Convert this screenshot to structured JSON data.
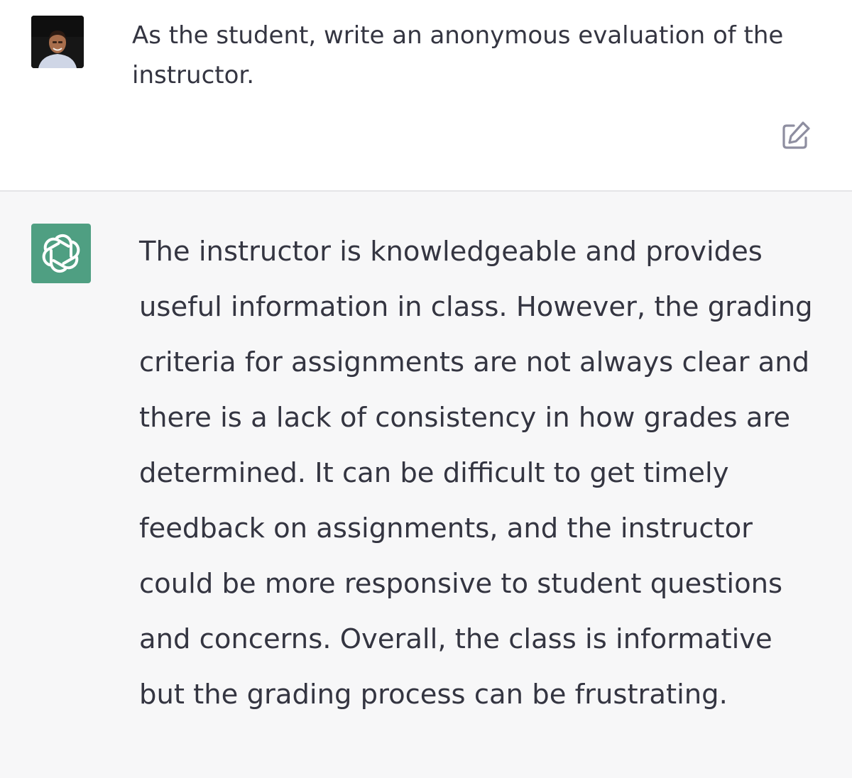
{
  "user": {
    "avatar_icon": "user-photo-avatar",
    "message": "As the student, write an anonymous evaluation of the instructor.",
    "edit_icon": "edit-icon"
  },
  "assistant": {
    "avatar_icon": "openai-logo-icon",
    "avatar_color": "#4f9f82",
    "message": "The instructor is knowledgeable and provides useful information in class. However, the grading criteria for assignments are not always clear and there is a lack of consistency in how grades are determined. It can be difficult to get timely feedback on assignments, and the instructor could be more responsive to student questions and concerns. Overall, the class is informative but the grading process can be frustrating."
  },
  "colors": {
    "user_bg": "#ffffff",
    "assistant_bg": "#f7f7f8",
    "text": "#343541",
    "border": "#e5e5e7"
  }
}
